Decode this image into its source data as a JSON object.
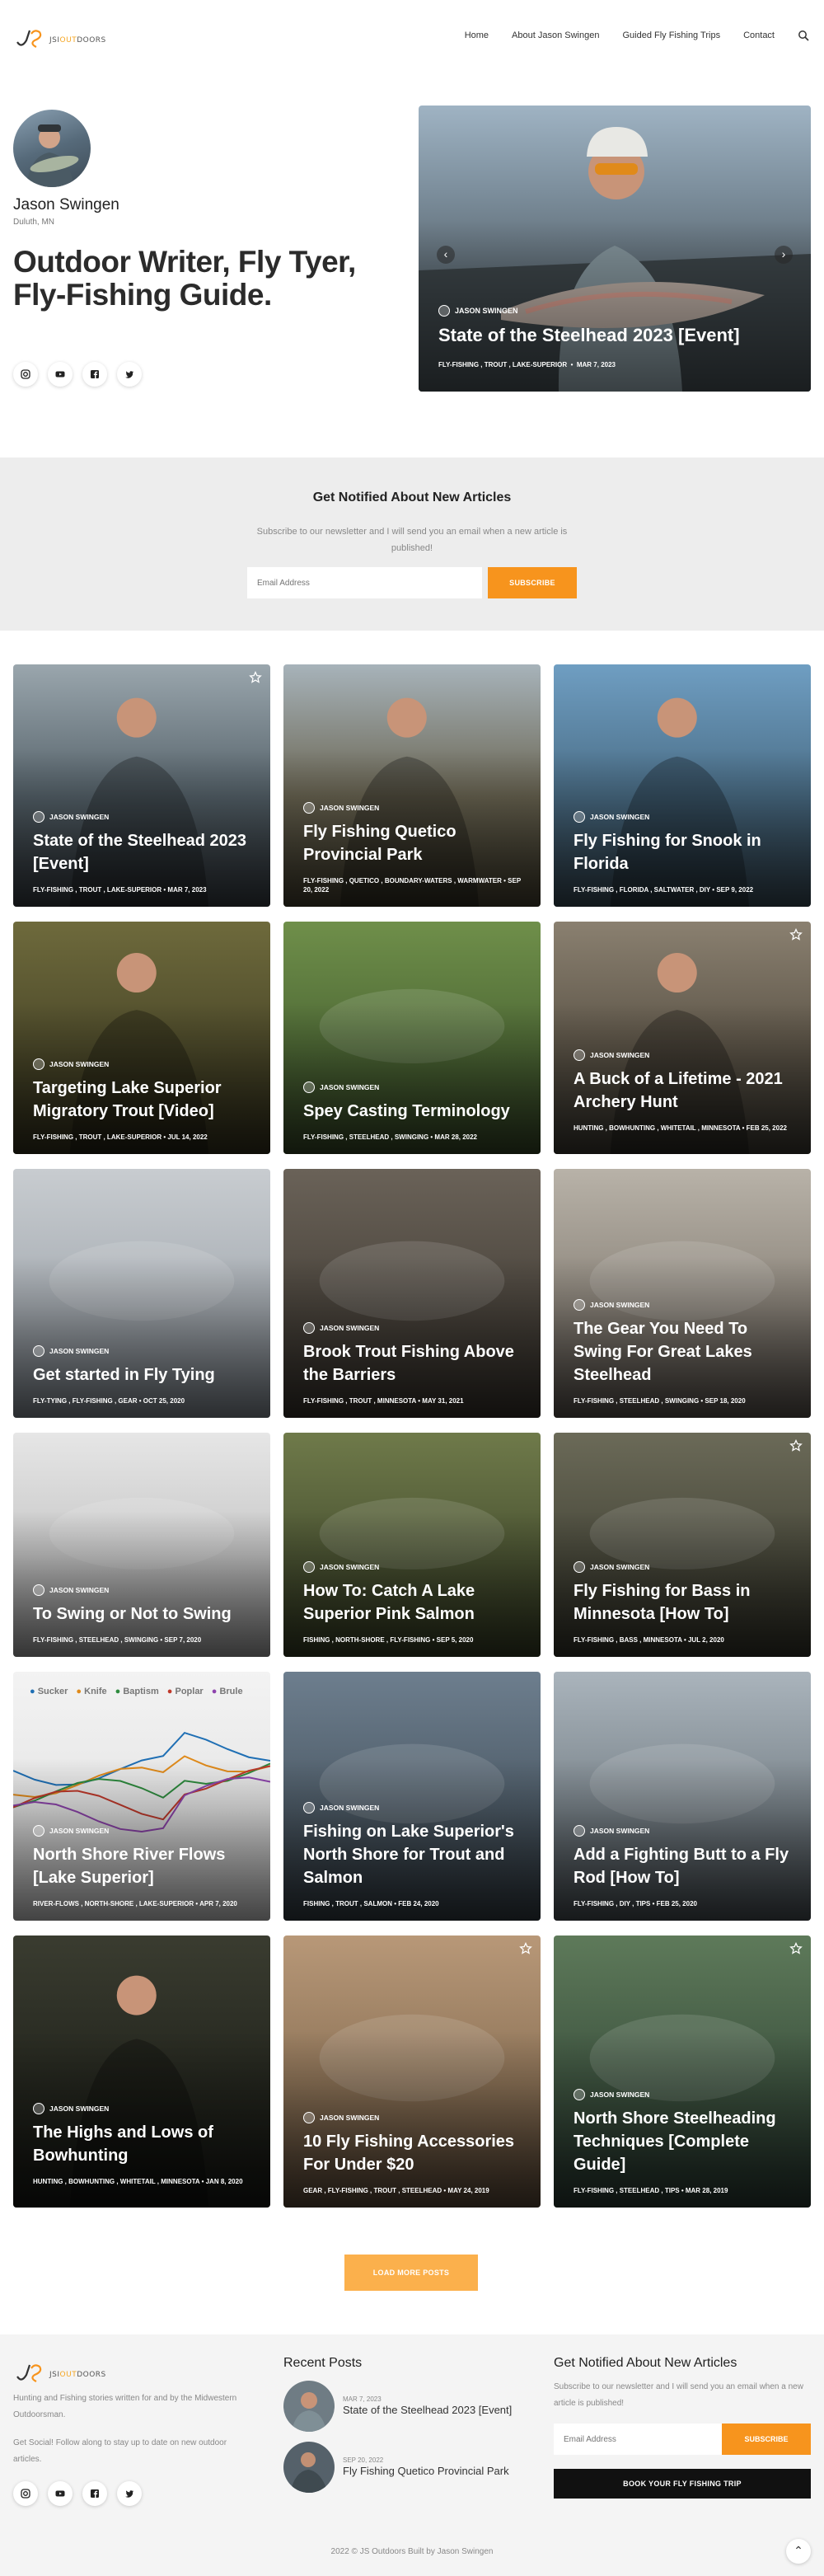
{
  "header": {
    "logo_prefix": "JSI",
    "logo_accent": "OUT",
    "logo_suffix": "DOORS",
    "nav": [
      "Home",
      "About Jason Swingen",
      "Guided Fly Fishing Trips",
      "Contact"
    ]
  },
  "hero": {
    "name": "Jason Swingen",
    "location": "Duluth, MN",
    "headline": "Outdoor Writer, Fly Tyer, Fly-Fishing Guide.",
    "featured": {
      "author": "JASON SWINGEN",
      "title": "State of the Steelhead 2023 [Event]",
      "tags": "FLY-FISHING , TROUT , LAKE-SUPERIOR",
      "date": "MAR 7, 2023"
    }
  },
  "newsletter": {
    "title": "Get Notified About New Articles",
    "description": "Subscribe to our newsletter and I will send you an email when a new article is published!",
    "placeholder": "Email Address",
    "button": "SUBSCRIBE"
  },
  "posts": [
    {
      "title": "State of the Steelhead 2023 [Event]",
      "tags": "FLY-FISHING , TROUT , LAKE-SUPERIOR",
      "date": "MAR 7, 2023",
      "starred": true
    },
    {
      "title": "Fly Fishing Quetico Provincial Park",
      "tags": "FLY-FISHING , QUETICO , BOUNDARY-WATERS , WARMWATER",
      "date": "SEP 20, 2022",
      "starred": false
    },
    {
      "title": "Fly Fishing for Snook in Florida",
      "tags": "FLY-FISHING , FLORIDA , SALTWATER , DIY",
      "date": "SEP 9, 2022",
      "starred": false
    },
    {
      "title": "Targeting Lake Superior Migratory Trout [Video]",
      "tags": "FLY-FISHING , TROUT , LAKE-SUPERIOR",
      "date": "JUL 14, 2022",
      "starred": false
    },
    {
      "title": "Spey Casting Terminology",
      "tags": "FLY-FISHING , STEELHEAD , SWINGING",
      "date": "MAR 28, 2022",
      "starred": false
    },
    {
      "title": "A Buck of a Lifetime - 2021 Archery Hunt",
      "tags": "HUNTING , BOWHUNTING , WHITETAIL , MINNESOTA",
      "date": "FEB 25, 2022",
      "starred": true
    },
    {
      "title": "Get started in Fly Tying",
      "tags": "FLY-TYING , FLY-FISHING , GEAR",
      "date": "OCT 25, 2020",
      "starred": false
    },
    {
      "title": "Brook Trout Fishing Above the Barriers",
      "tags": "FLY-FISHING , TROUT , MINNESOTA",
      "date": "MAY 31, 2021",
      "starred": false
    },
    {
      "title": "The Gear You Need To Swing For Great Lakes Steelhead",
      "tags": "FLY-FISHING , STEELHEAD , SWINGING",
      "date": "SEP 18, 2020",
      "starred": false
    },
    {
      "title": "To Swing or Not to Swing",
      "tags": "FLY-FISHING , STEELHEAD , SWINGING",
      "date": "SEP 7, 2020",
      "starred": false
    },
    {
      "title": "How To: Catch A Lake Superior Pink Salmon",
      "tags": "FISHING , NORTH-SHORE , FLY-FISHING",
      "date": "SEP 5, 2020",
      "starred": false
    },
    {
      "title": "Fly Fishing for Bass in Minnesota [How To]",
      "tags": "FLY-FISHING , BASS , MINNESOTA",
      "date": "JUL 2, 2020",
      "starred": true
    },
    {
      "title": "North Shore River Flows [Lake Superior]",
      "tags": "RIVER-FLOWS , NORTH-SHORE , LAKE-SUPERIOR",
      "date": "APR 7, 2020",
      "starred": false,
      "legend": [
        "Sucker",
        "Knife",
        "Baptism",
        "Poplar",
        "Brule"
      ]
    },
    {
      "title": "Fishing on Lake Superior's North Shore for Trout and Salmon",
      "tags": "FISHING , TROUT , SALMON",
      "date": "FEB 24, 2020",
      "starred": false
    },
    {
      "title": "Add a Fighting Butt to a Fly Rod [How To]",
      "tags": "FLY-FISHING , DIY , TIPS",
      "date": "FEB 25, 2020",
      "starred": false
    },
    {
      "title": "The Highs and Lows of Bowhunting",
      "tags": "HUNTING , BOWHUNTING , WHITETAIL , MINNESOTA",
      "date": "JAN 8, 2020",
      "starred": false
    },
    {
      "title": "10 Fly Fishing Accessories For Under $20",
      "tags": "GEAR , FLY-FISHING , TROUT , STEELHEAD",
      "date": "MAY 24, 2019",
      "starred": true
    },
    {
      "title": "North Shore Steelheading Techniques [Complete Guide]",
      "tags": "FLY-FISHING , STEELHEAD , TIPS",
      "date": "MAR 28, 2019",
      "starred": true
    }
  ],
  "post_author": "JASON SWINGEN",
  "load_more": "LOAD MORE POSTS",
  "footer": {
    "about": "Hunting and Fishing stories written for and by the Midwestern Outdoorsman.",
    "social_text": "Get Social! Follow along to stay up to date on new outdoor articles.",
    "recent_title": "Recent Posts",
    "recent": [
      {
        "date": "MAR 7, 2023",
        "title": "State of the Steelhead 2023 [Event]"
      },
      {
        "date": "SEP 20, 2022",
        "title": "Fly Fishing Quetico Provincial Park"
      }
    ],
    "nl_title": "Get Notified About New Articles",
    "nl_text": "Subscribe to our newsletter and I will send you an email when a new article is published!",
    "nl_placeholder": "Email Address",
    "nl_button": "SUBSCRIBE",
    "book_button": "BOOK YOUR FLY FISHING TRIP",
    "copyright": "2022 © JS Outdoors Built by Jason Swingen"
  },
  "colors": {
    "accent": "#f7941d"
  }
}
